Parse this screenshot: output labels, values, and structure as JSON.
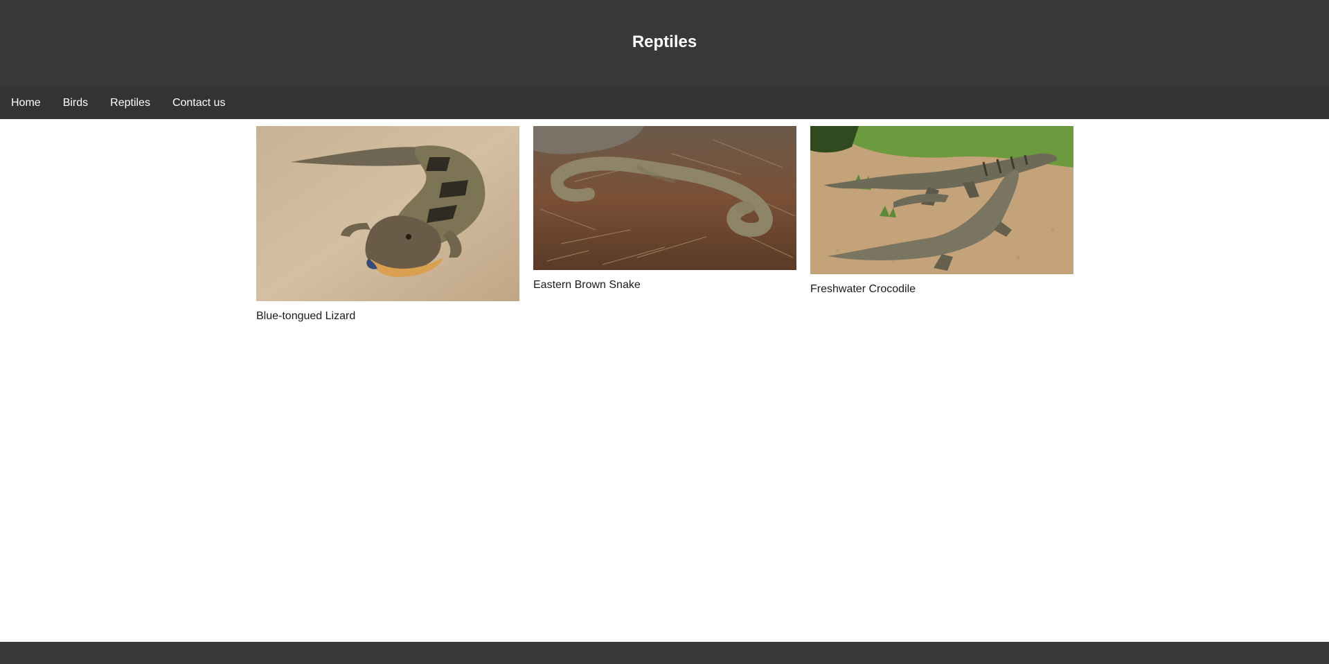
{
  "header": {
    "title": "Reptiles"
  },
  "nav": {
    "items": [
      {
        "label": "Home"
      },
      {
        "label": "Birds"
      },
      {
        "label": "Reptiles"
      },
      {
        "label": "Contact us"
      }
    ]
  },
  "gallery": {
    "cards": [
      {
        "caption": "Blue-tongued Lizard",
        "image": "blue-tongued-lizard-photo"
      },
      {
        "caption": "Eastern Brown Snake",
        "image": "eastern-brown-snake-photo"
      },
      {
        "caption": "Freshwater Crocodile",
        "image": "freshwater-crocodile-photo"
      }
    ]
  },
  "colors": {
    "header_bg": "#383838",
    "nav_bg": "#333333",
    "nav_text": "#ffffff",
    "caption_text": "#1a1a1a"
  }
}
